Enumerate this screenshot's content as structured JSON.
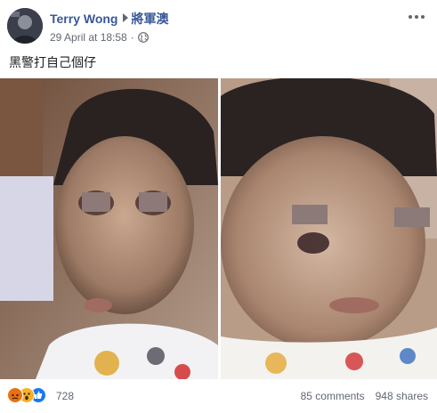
{
  "post": {
    "author": "Terry Wong",
    "target": "將軍澳",
    "timestamp": "29 April at 18:58",
    "separator": "·",
    "audience_icon": "globe-icon",
    "text": "黑警打自己個仔"
  },
  "footer": {
    "reactions": [
      "angry-reaction-icon",
      "wow-reaction-icon",
      "like-reaction-icon"
    ],
    "reaction_count": "728",
    "comments": "85 comments",
    "shares": "948 shares"
  },
  "colors": {
    "link": "#385898",
    "meta": "#616770",
    "like": "#1877f2",
    "angry": "#e9710f",
    "wow": "#f7b125"
  }
}
